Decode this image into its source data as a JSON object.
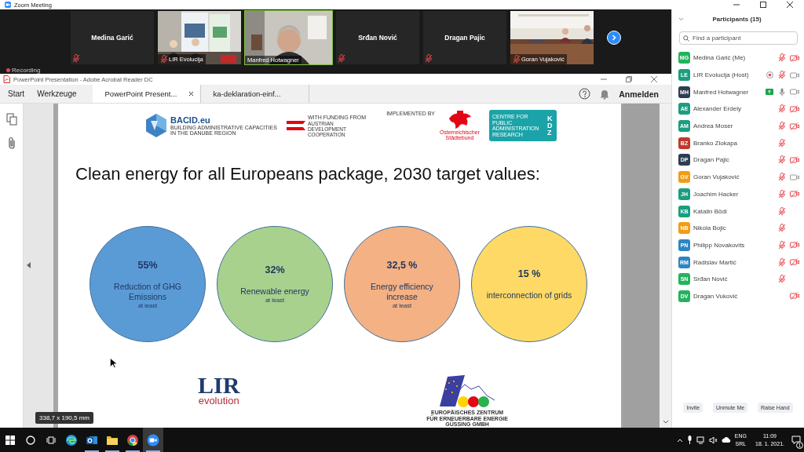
{
  "window": {
    "title": "Zoom Meeting"
  },
  "video_tiles": [
    {
      "name": "Medina Garić",
      "video": false,
      "muted": true,
      "active": false
    },
    {
      "name": "LIR Evolucija",
      "video": true,
      "muted": true,
      "active": false
    },
    {
      "name": "Manfred Hotwagner",
      "video": true,
      "muted": false,
      "active": true
    },
    {
      "name": "Srđan Nović",
      "video": false,
      "muted": true,
      "active": false
    },
    {
      "name": "Dragan Pajic",
      "video": false,
      "muted": true,
      "active": false
    },
    {
      "name": "Goran Vujaković",
      "video": true,
      "muted": true,
      "active": false
    }
  ],
  "recording": {
    "label": "Recording"
  },
  "reader": {
    "title": "PowerPoint Presentation - Adobe Acrobat Reader DC",
    "nav": [
      "Start",
      "Werkzeuge"
    ],
    "tabs": [
      {
        "label": "PowerPoint Present...",
        "selected": true
      },
      {
        "label": "ka-deklaration-einf...",
        "selected": false
      }
    ],
    "sign_in": "Anmelden",
    "page_size": "338,7 x 190,5 mm",
    "slide": {
      "logos_top": [
        {
          "kind": "bacid",
          "name": "BACID.eu",
          "caption": "BUILDING ADMINISTRATIVE CAPACITIES\nIN THE DANUBE REGION"
        },
        {
          "kind": "ada",
          "caption": "WITH FUNDING FROM",
          "name": "AUSTRIAN\nDEVELOPMENT\nCOOPERATION"
        },
        {
          "kind": "staedtebund",
          "caption": "IMPLEMENTED BY",
          "name": "Österreichischer\nStädtebund"
        },
        {
          "kind": "kdz",
          "name": "KDZ",
          "caption": "CENTRE FOR\nPUBLIC\nADMINISTRATION\nRESEARCH"
        }
      ],
      "title": "Clean energy for all Europeans package, 2030 target values:",
      "targets": [
        {
          "value": "55%",
          "label": "Reduction of GHG Emissions",
          "note": "at least",
          "color": "#5b9bd5"
        },
        {
          "value": "32%",
          "label": "Renewable energy",
          "note": "at least",
          "color": "#a9d18e"
        },
        {
          "value": "32,5 %",
          "label": "Energy efficiency increase",
          "note": "at least",
          "color": "#f4b183"
        },
        {
          "value": "15 %",
          "label": "interconnection of grids",
          "color": "#ffd966"
        }
      ],
      "logos_bottom": [
        {
          "kind": "lir",
          "name": "LIR",
          "caption": "evolution"
        },
        {
          "kind": "eee",
          "caption": "EUROPÄISCHES ZENTRUM\nFÜR ERNEUERBARE ENERGIE\nGÜSSING GMBH"
        }
      ]
    }
  },
  "participants_panel": {
    "title": "Participants (15)",
    "search": {
      "placeholder": "Find a participant"
    },
    "participants": [
      {
        "initials": "MG",
        "name": "Medina Garić (Me)",
        "color": "#23b35e",
        "recording": false,
        "sharing": false,
        "audio": true,
        "muted": true,
        "video": true,
        "camera_on": false
      },
      {
        "initials": "LE",
        "name": "LIR Evolucija (Host)",
        "color": "#1a9e80",
        "recording": true,
        "sharing": false,
        "audio": true,
        "muted": true,
        "video": true,
        "camera_on": true
      },
      {
        "initials": "MH",
        "name": "Manfred Hotwagner",
        "color": "#2d3e50",
        "recording": false,
        "sharing": true,
        "audio": true,
        "muted": false,
        "video": true,
        "camera_on": true
      },
      {
        "initials": "AE",
        "name": "Alexander Erdely",
        "color": "#1a9e80",
        "recording": false,
        "sharing": false,
        "audio": true,
        "muted": true,
        "video": true,
        "camera_on": false
      },
      {
        "initials": "AM",
        "name": "Andrea Moser",
        "color": "#1a9e80",
        "recording": false,
        "sharing": false,
        "audio": true,
        "muted": true,
        "video": true,
        "camera_on": false
      },
      {
        "initials": "BZ",
        "name": "Branko Zlokapa",
        "color": "#c0392b",
        "recording": false,
        "sharing": false,
        "audio": true,
        "muted": true,
        "video": false
      },
      {
        "initials": "DP",
        "name": "Dragan Pajic",
        "color": "#2d3e50",
        "recording": false,
        "sharing": false,
        "audio": true,
        "muted": true,
        "video": true,
        "camera_on": false
      },
      {
        "initials": "GV",
        "name": "Goran Vujaković",
        "color": "#f39c12",
        "recording": false,
        "sharing": false,
        "audio": true,
        "muted": true,
        "video": true,
        "camera_on": true
      },
      {
        "initials": "JH",
        "name": "Joachim Hacker",
        "color": "#1a9e80",
        "recording": false,
        "sharing": false,
        "audio": true,
        "muted": true,
        "video": true,
        "camera_on": false
      },
      {
        "initials": "KB",
        "name": "Katalin Bödi",
        "color": "#1a9e80",
        "recording": false,
        "sharing": false,
        "audio": true,
        "muted": true,
        "video": false
      },
      {
        "initials": "NB",
        "name": "Nikola Bojic",
        "color": "#f39c12",
        "recording": false,
        "sharing": false,
        "audio": true,
        "muted": true,
        "video": false
      },
      {
        "initials": "PN",
        "name": "Philipp Novakovits",
        "color": "#2e86c1",
        "recording": false,
        "sharing": false,
        "audio": true,
        "muted": true,
        "video": true,
        "camera_on": false
      },
      {
        "initials": "RM",
        "name": "Radislav Martić",
        "color": "#2e86c1",
        "recording": false,
        "sharing": false,
        "audio": true,
        "muted": true,
        "video": true,
        "camera_on": false
      },
      {
        "initials": "SN",
        "name": "Srđan Nović",
        "color": "#23b35e",
        "recording": false,
        "sharing": false,
        "audio": true,
        "muted": true,
        "video": false
      },
      {
        "initials": "DV",
        "name": "Dragan Vuković",
        "color": "#23b35e",
        "recording": false,
        "sharing": false,
        "audio": false,
        "video": true,
        "camera_on": false
      }
    ],
    "buttons": [
      "Invite",
      "Unmute Me",
      "Raise Hand"
    ]
  },
  "taskbar": {
    "apps": [
      {
        "kind": "edge",
        "running": false,
        "selected": false
      },
      {
        "kind": "mail",
        "running": true,
        "selected": false
      },
      {
        "kind": "folder",
        "running": true,
        "selected": false
      },
      {
        "kind": "chrome",
        "running": true,
        "selected": false
      },
      {
        "kind": "video",
        "running": true,
        "selected": true
      }
    ],
    "language": "ENG",
    "layout": "SRL",
    "time": "11:09",
    "date": "18. 1. 2021.",
    "notifications": "1"
  }
}
